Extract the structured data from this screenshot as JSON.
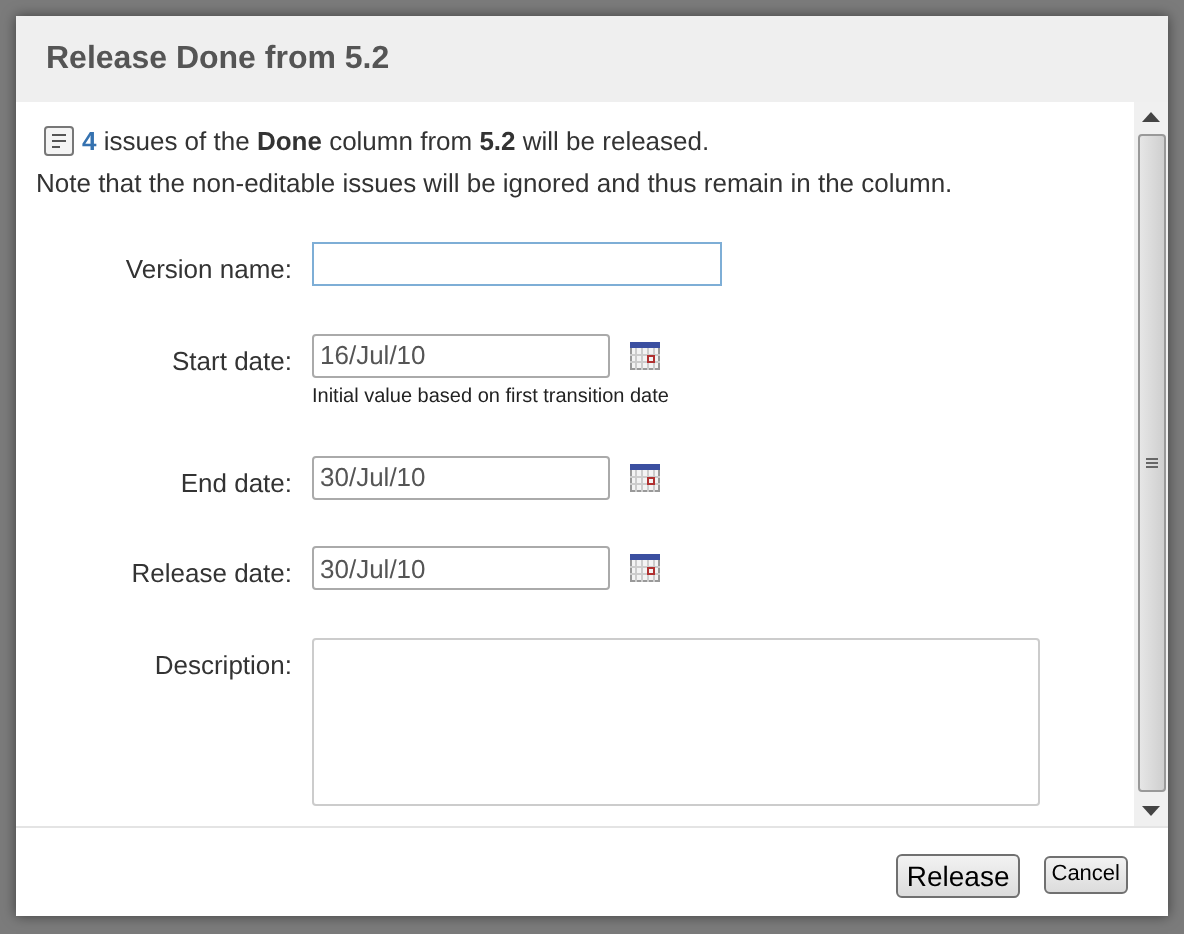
{
  "dialog": {
    "title": "Release Done from 5.2",
    "intro": {
      "count": "4",
      "text": "issues of the **Done** column from **5.2** will be released."
    },
    "note": "Note that the non-editable issues will be ignored and thus remain in the column.",
    "fields": [
      {
        "kind": "text",
        "label": "Version name:",
        "focused": true
      },
      {
        "kind": "date",
        "label": "Start date:",
        "value": "16/Jul/10",
        "hint": "Initial value based on first transition date"
      },
      {
        "kind": "date",
        "label": "End date:",
        "value": "30/Jul/10"
      },
      {
        "kind": "date",
        "label": "Release date:",
        "value": "30/Jul/10"
      },
      {
        "kind": "textarea",
        "label": "Description:"
      }
    ],
    "buttons": [
      {
        "label": "Release",
        "kind": "primary"
      },
      {
        "label": "Cancel",
        "kind": "secondary"
      }
    ]
  }
}
